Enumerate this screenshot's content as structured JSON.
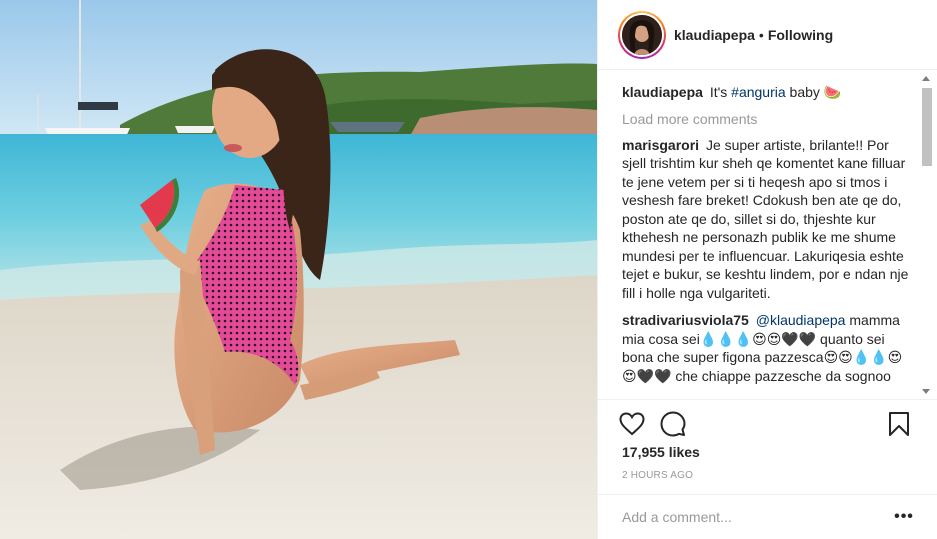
{
  "post": {
    "image_alt": "Woman in pink swimsuit sitting on beach holding watermelon",
    "header": {
      "username": "klaudiapepa",
      "separator": "•",
      "follow_label": "Following"
    },
    "caption": {
      "author": "klaudiapepa",
      "text_before": "It's",
      "hashtag": "#anguria",
      "text_after": "baby 🍉"
    },
    "load_more": "Load more comments",
    "comments": [
      {
        "author": "marisgarori",
        "mention": "",
        "text": "Je super artiste, brilante!! Por sjell trishtim kur sheh qe komentet kane filluar te jene vetem per si ti heqesh apo si tmos i veshesh fare breket! Cdokush ben ate qe do, poston ate qe do, sillet si do, thjeshte kur kthehesh ne personazh publik ke me shume mundesi per te influencuar. Lakuriqesia eshte tejet e bukur, se keshtu lindem, por e ndan nje fill i holle nga vulgariteti."
      },
      {
        "author": "stradivariusviola75",
        "mention": "@klaudiapepa",
        "text": "mamma mia cosa sei💧💧💧😍😍🖤🖤 quanto sei bona che super figona pazzesca😍😍💧💧😍😍🖤🖤 che chiappe pazzesche da sognoo"
      },
      {
        "author": "",
        "mention": "",
        "text": ""
      }
    ],
    "likes": "17,955 likes",
    "timestamp": "2 HOURS AGO",
    "add_comment_placeholder": "Add a comment...",
    "more_label": "•••"
  },
  "colors": {
    "link": "#003569",
    "muted": "#999999",
    "text": "#262626",
    "border": "#efefef"
  },
  "icons": {
    "like": "heart-icon",
    "comment": "speech-bubble-icon",
    "save": "bookmark-icon",
    "more": "more-options-icon"
  }
}
